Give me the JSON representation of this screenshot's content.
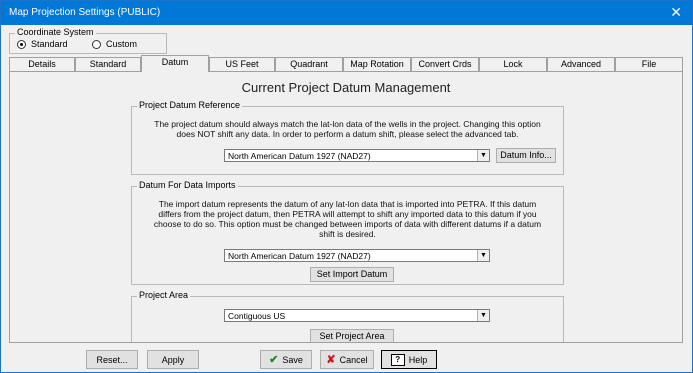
{
  "window": {
    "title": "Map Projection Settings (PUBLIC)"
  },
  "coordinate_system": {
    "label": "Coordinate System",
    "options": [
      "Standard",
      "Custom"
    ],
    "selected": "Standard"
  },
  "tabs": [
    "Details",
    "Standard",
    "Datum",
    "US Feet",
    "Quadrant",
    "Map Rotation",
    "Convert Crds",
    "Lock",
    "Advanced",
    "File"
  ],
  "active_tab": "Datum",
  "heading": "Current Project Datum Management",
  "project_datum": {
    "label": "Project Datum Reference",
    "text": "The project datum should always match the lat-lon data of the wells in the project. Changing this option does NOT shift any data. In order to perform a datum shift, please select the advanced tab.",
    "value": "North American Datum 1927 (NAD27)",
    "info_button": "Datum Info..."
  },
  "import_datum": {
    "label": "Datum For Data Imports",
    "text": "The import datum represents the datum of any lat-lon data that is imported into PETRA. If this datum differs from the project datum, then PETRA will attempt to shift any imported data to this datum if you choose to do so. This option must be changed between imports of data with different datums if a datum shift is desired.",
    "value": "North American Datum 1927 (NAD27)",
    "button": "Set Import Datum"
  },
  "project_area": {
    "label": "Project Area",
    "value": "Contiguous US",
    "button": "Set Project Area"
  },
  "footer": {
    "reset": "Reset...",
    "apply": "Apply",
    "save": "Save",
    "cancel": "Cancel",
    "help": "Help"
  }
}
